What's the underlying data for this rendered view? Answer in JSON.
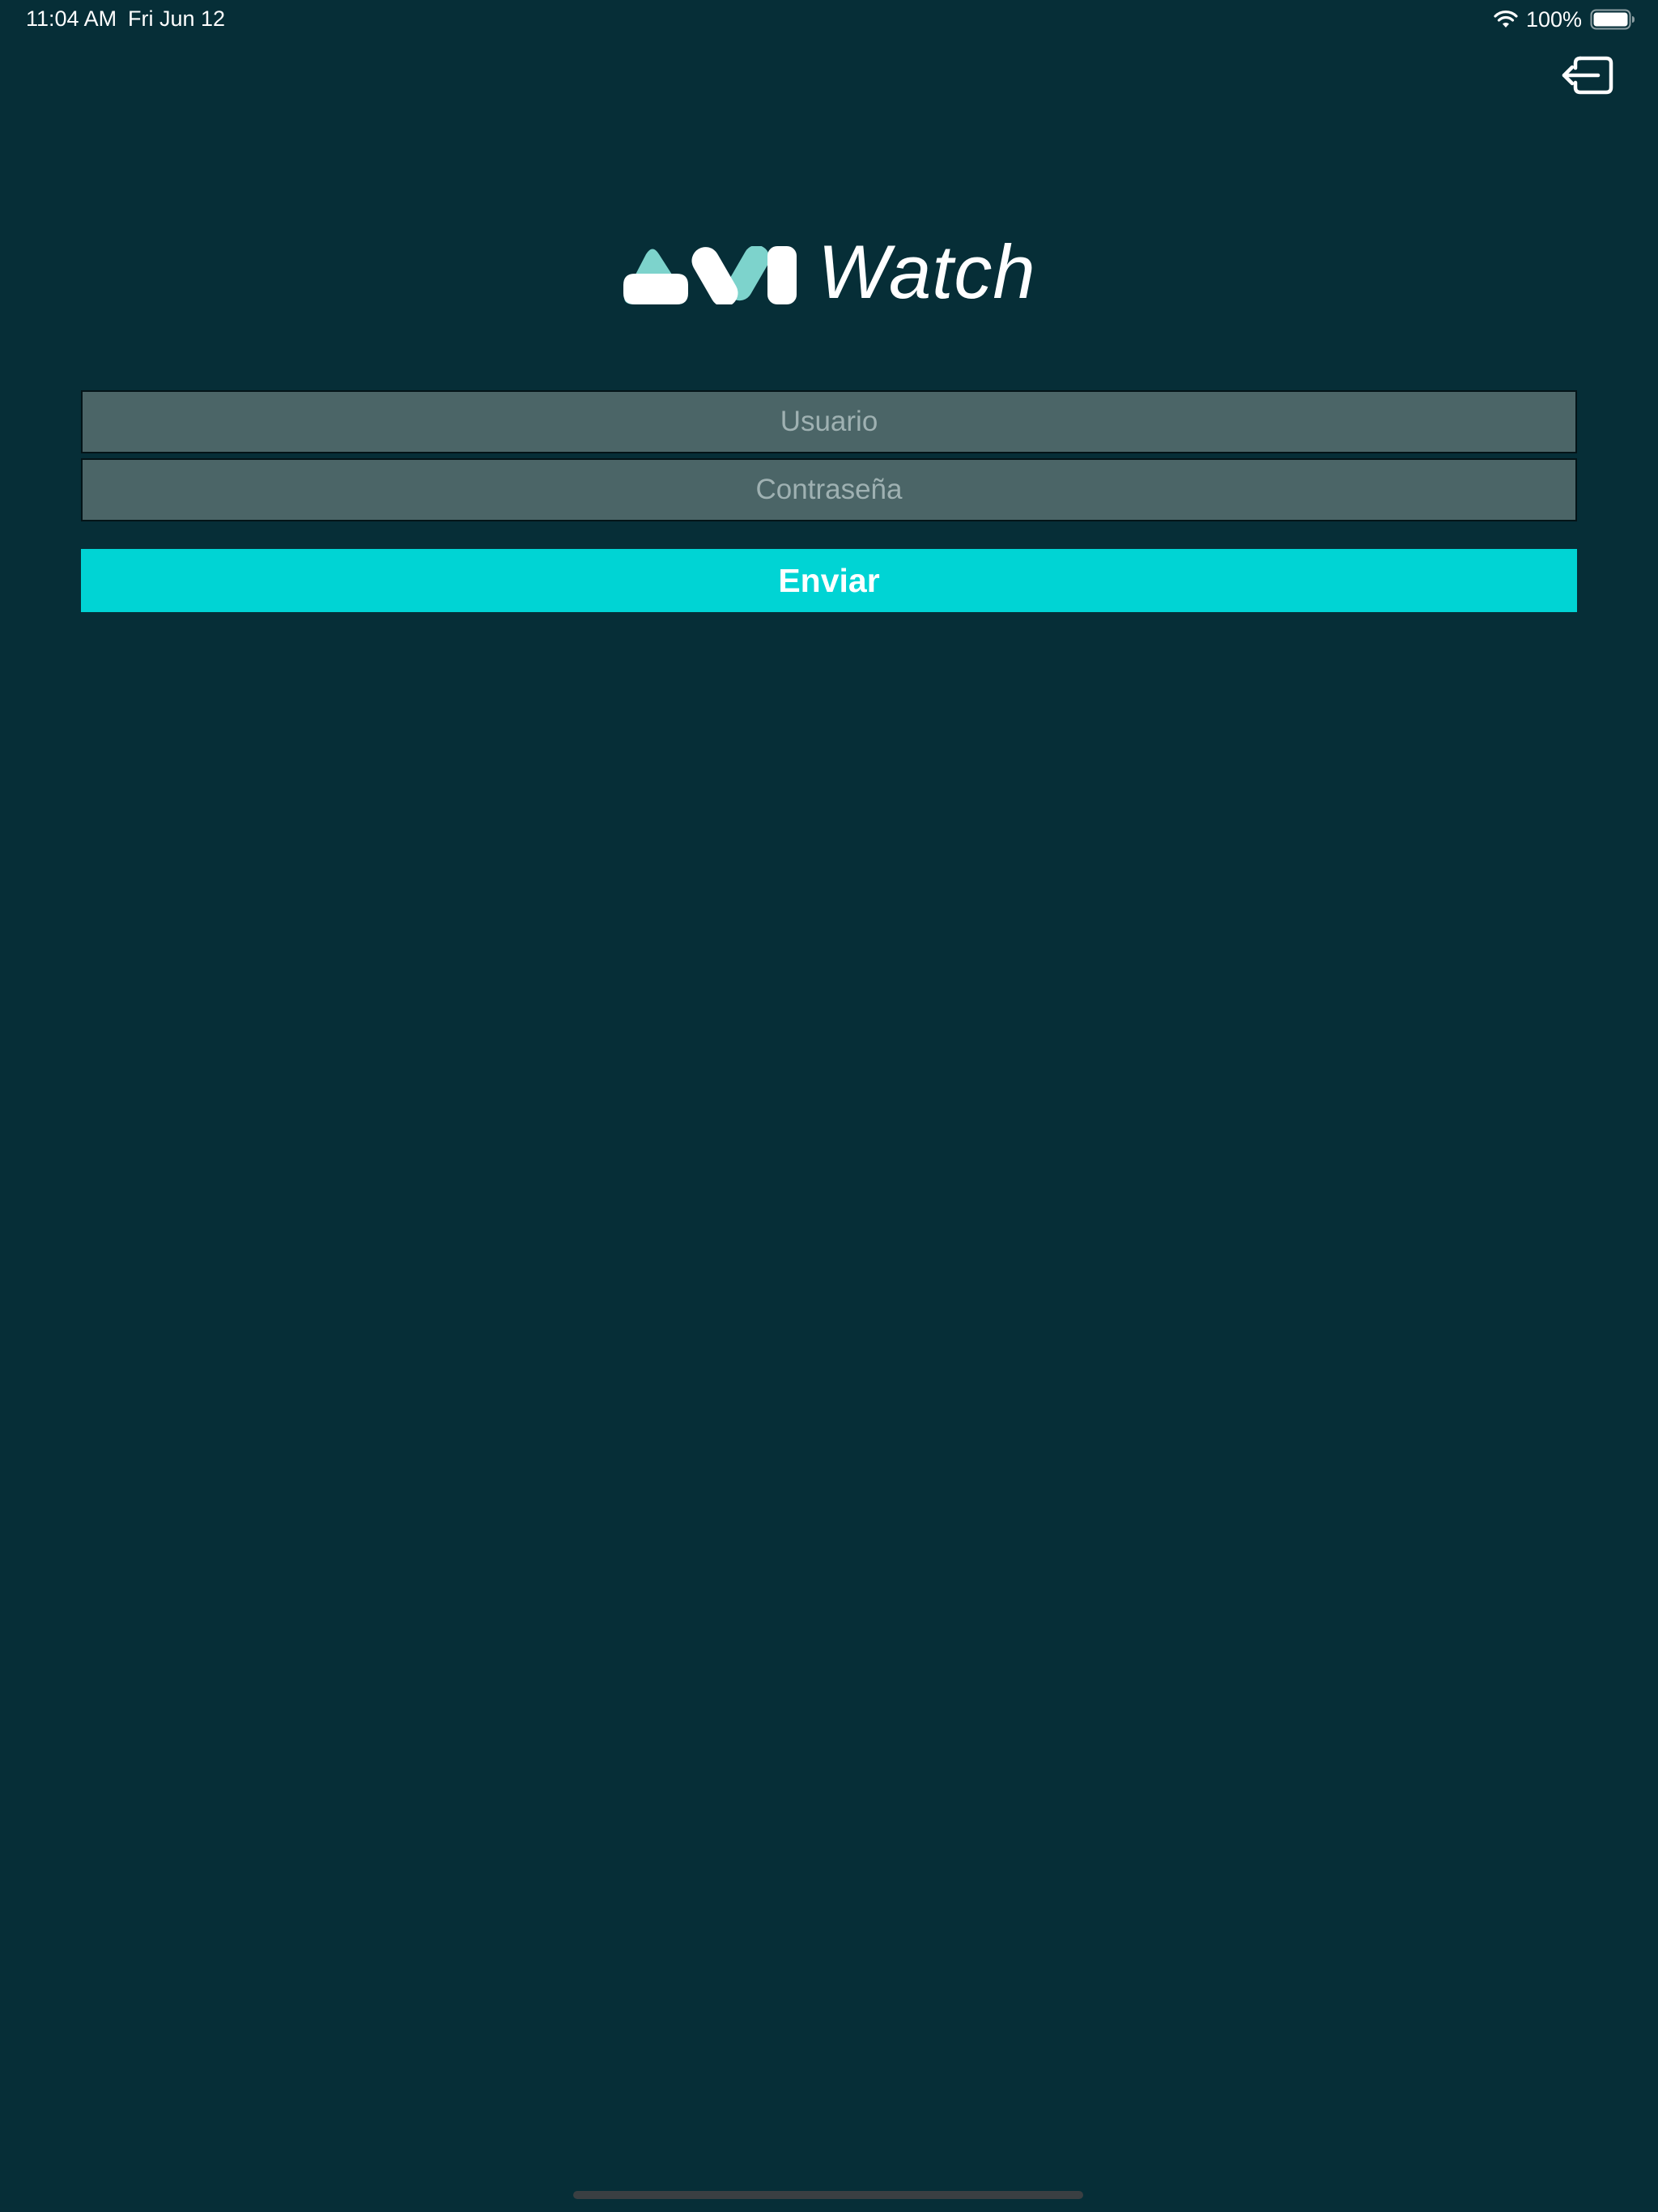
{
  "status_bar": {
    "time": "11:04 AM",
    "date": "Fri Jun 12",
    "battery_percent": "100%",
    "icons": [
      "wifi-icon",
      "battery-icon"
    ]
  },
  "header": {
    "exit_icon": "logout-icon"
  },
  "logo": {
    "text": "Watch",
    "mark_icon": "avi-logo-mark",
    "colors": {
      "primary": "#ffffff",
      "accent": "#7dd3cc"
    }
  },
  "login_form": {
    "username": {
      "placeholder": "Usuario",
      "value": ""
    },
    "password": {
      "placeholder": "Contraseña",
      "value": ""
    },
    "submit_label": "Enviar"
  },
  "theme": {
    "background": "#062e37",
    "field_background": "#4b6567",
    "button_background": "#00d4d4"
  }
}
